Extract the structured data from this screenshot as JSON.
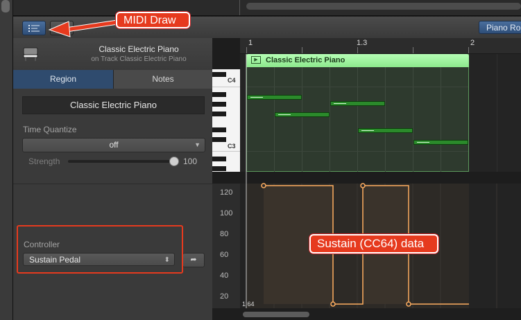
{
  "toolbar": {
    "piano_roll_label": "Piano Ro"
  },
  "inspector": {
    "track_title": "Classic Electric Piano",
    "track_subtitle": "on Track Classic Electric Piano",
    "tabs": [
      {
        "label": "Region",
        "active": true
      },
      {
        "label": "Notes",
        "active": false
      }
    ],
    "region_name": "Classic Electric Piano",
    "time_quantize_label": "Time Quantize",
    "time_quantize_value": "off",
    "strength_label": "Strength",
    "strength_value": "100",
    "controller_label": "Controller",
    "controller_value": "Sustain Pedal"
  },
  "keyboard": {
    "labels": [
      "C4",
      "C3"
    ]
  },
  "ruler": {
    "markers": [
      "1",
      "1.3",
      "2"
    ]
  },
  "region": {
    "title": "Classic Electric Piano"
  },
  "lane": {
    "scale": [
      "120",
      "100",
      "80",
      "60",
      "40",
      "20"
    ],
    "position": "1 64"
  },
  "callouts": {
    "midi_draw": "MIDI Draw",
    "sustain": "Sustain (CC64) data"
  },
  "icons": [
    "midi-draw-icon",
    "piano-instrument-icon",
    "region-play-icon",
    "controller-learn-icon",
    "dropdown-arrow-icon"
  ],
  "colors": {
    "accent_blue": "#2f4b6e",
    "region_green": "#8ce88c",
    "note_green": "#2b8a2b",
    "automation_orange": "#ffae60",
    "callout_red": "#e63a1e"
  }
}
